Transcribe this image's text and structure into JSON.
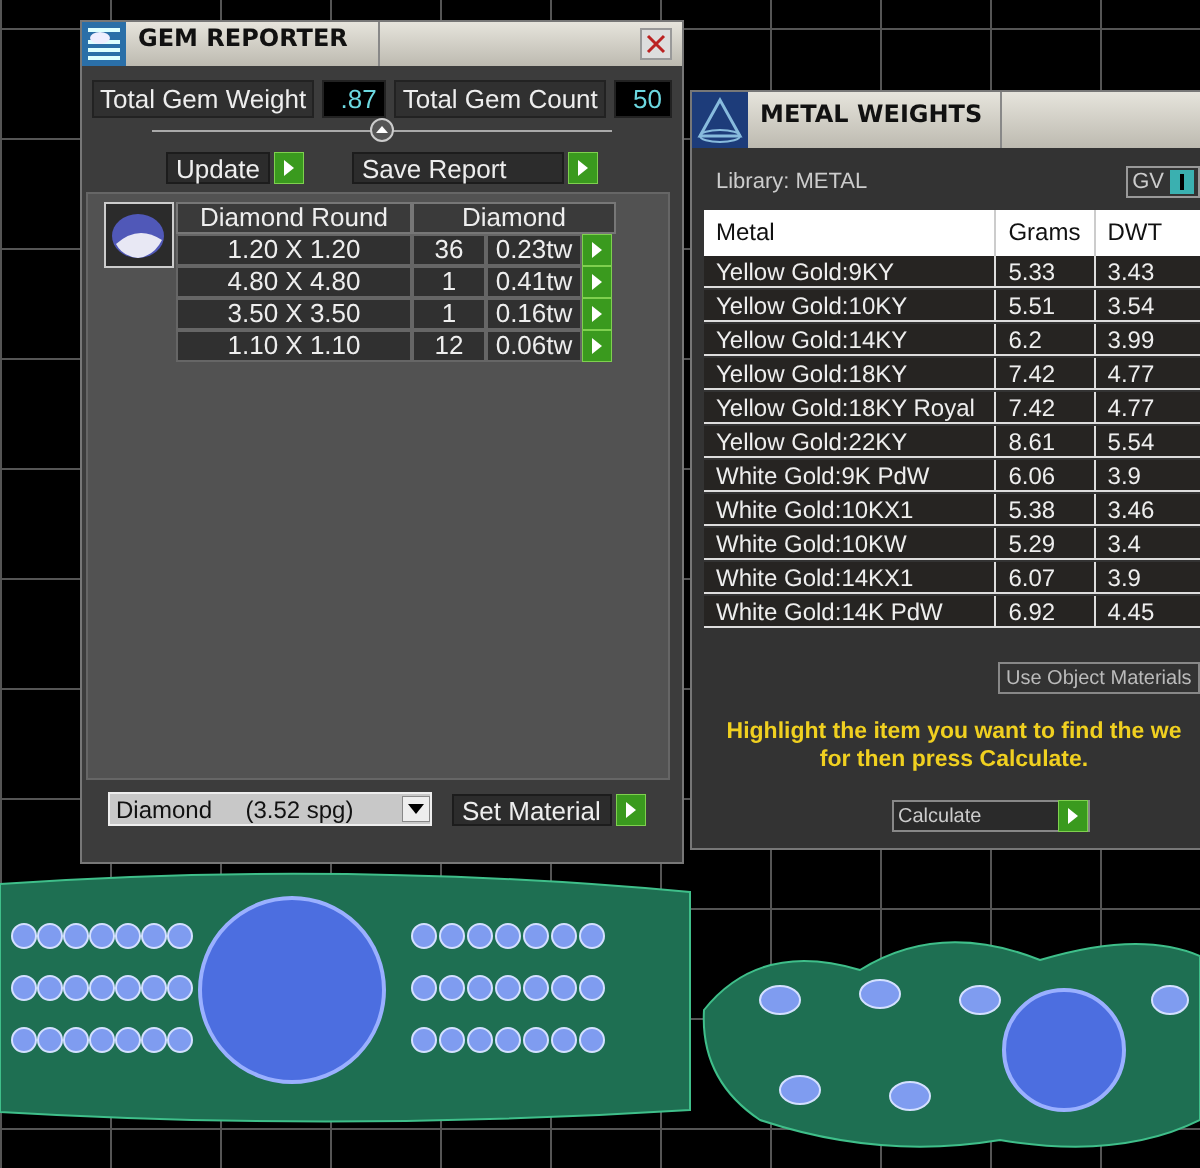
{
  "gem_reporter": {
    "title": "GEM REPORTER",
    "total_gem_weight": {
      "label": "Total Gem Weight",
      "value": ".87"
    },
    "total_gem_count": {
      "label": "Total Gem Count",
      "value": "50"
    },
    "buttons": [
      "Update",
      "Save Report"
    ],
    "table": {
      "columns": [
        "Diamond Round",
        "Diamond"
      ],
      "rows": [
        {
          "size": "1.20 X 1.20",
          "count": "36",
          "weight": "0.23tw"
        },
        {
          "size": "4.80 X 4.80",
          "count": "1",
          "weight": "0.41tw"
        },
        {
          "size": "3.50 X 3.50",
          "count": "1",
          "weight": "0.16tw"
        },
        {
          "size": "1.10 X 1.10",
          "count": "12",
          "weight": "0.06tw"
        }
      ]
    },
    "material_select": {
      "value": "Diamond",
      "detail": "(3.52 spg)"
    },
    "set_material_button": "Set Material"
  },
  "metal_weights": {
    "title": "METAL WEIGHTS",
    "library": "Library: METAL",
    "gv_toggle": {
      "label": "GV",
      "on": true
    },
    "table": {
      "columns": [
        "Metal",
        "Grams",
        "DWT"
      ],
      "rows": [
        [
          "Yellow Gold:9KY",
          "5.33",
          "3.43"
        ],
        [
          "Yellow Gold:10KY",
          "5.51",
          "3.54"
        ],
        [
          "Yellow Gold:14KY",
          "6.2",
          "3.99"
        ],
        [
          "Yellow Gold:18KY",
          "7.42",
          "4.77"
        ],
        [
          "Yellow Gold:18KY Royal",
          "7.42",
          "4.77"
        ],
        [
          "Yellow Gold:22KY",
          "8.61",
          "5.54"
        ],
        [
          "White Gold:9K PdW",
          "6.06",
          "3.9"
        ],
        [
          "White Gold:10KX1",
          "5.38",
          "3.46"
        ],
        [
          "White Gold:10KW",
          "5.29",
          "3.4"
        ],
        [
          "White Gold:14KX1",
          "6.07",
          "3.9"
        ],
        [
          "White Gold:14K PdW",
          "6.92",
          "4.45"
        ]
      ]
    },
    "use_object_materials_button": "Use Object Materials",
    "instruction_lines": [
      "Highlight the item you want to find the we",
      "for then press Calculate."
    ],
    "calculate_button": "Calculate"
  }
}
